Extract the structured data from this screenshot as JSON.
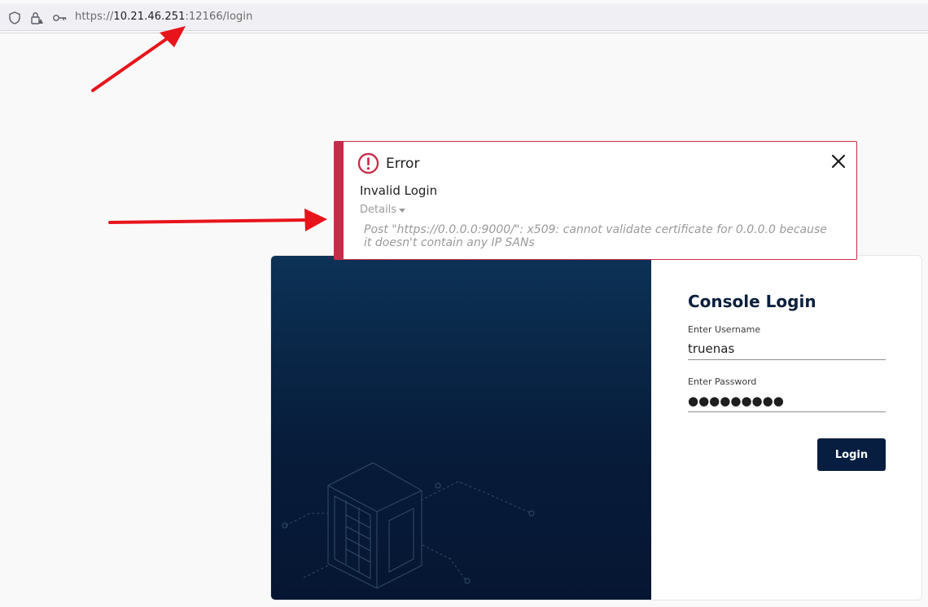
{
  "browser": {
    "url_scheme": "https://",
    "url_host": "10.21.46.251",
    "url_rest": ":12166/login",
    "icons": [
      "shield-icon",
      "lock-warning-icon",
      "key-icon"
    ]
  },
  "error": {
    "title": "Error",
    "message": "Invalid Login",
    "details_label": "Details",
    "details_text": "Post \"https://0.0.0.0:9000/\": x509: cannot validate certificate for 0.0.0.0 because it doesn't contain any IP SANs",
    "accent_color": "#c72c48"
  },
  "login": {
    "title": "Console Login",
    "username_label": "Enter Username",
    "username_value": "truenas",
    "password_label": "Enter Password",
    "password_value": "●●●●●●●●●",
    "button_label": "Login",
    "button_color": "#081e40"
  },
  "annotations": {
    "arrow_color": "#e8141b"
  }
}
